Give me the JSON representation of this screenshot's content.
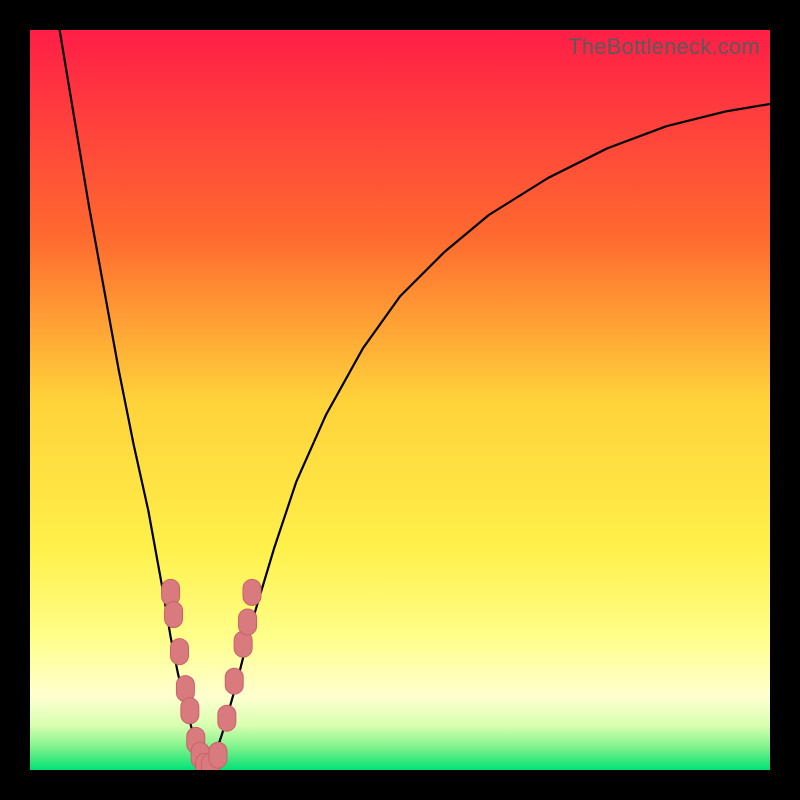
{
  "watermark": "TheBottleneck.com",
  "colors": {
    "frame_bg": "#000000",
    "gradient_stops": [
      {
        "offset": 0.0,
        "color": "#ff1e47"
      },
      {
        "offset": 0.28,
        "color": "#ff6a2f"
      },
      {
        "offset": 0.5,
        "color": "#ffd23a"
      },
      {
        "offset": 0.7,
        "color": "#fff04a"
      },
      {
        "offset": 0.82,
        "color": "#ffff8a"
      },
      {
        "offset": 0.9,
        "color": "#ffffd0"
      },
      {
        "offset": 0.94,
        "color": "#d8ffb0"
      },
      {
        "offset": 0.97,
        "color": "#7df28a"
      },
      {
        "offset": 1.0,
        "color": "#00e277"
      }
    ],
    "curve_stroke": "#000000",
    "marker_fill": "#d97a7e",
    "marker_stroke": "#c96168"
  },
  "chart_data": {
    "type": "line",
    "title": "",
    "xlabel": "",
    "ylabel": "",
    "xlim": [
      0,
      100
    ],
    "ylim": [
      0,
      100
    ],
    "series": [
      {
        "name": "left-branch",
        "x": [
          4,
          6,
          8,
          10,
          12,
          14,
          16,
          18,
          19,
          20,
          21,
          22,
          23,
          24
        ],
        "y": [
          100,
          88,
          76,
          65,
          54,
          44,
          35,
          24,
          18,
          13,
          9,
          5,
          2,
          0
        ]
      },
      {
        "name": "right-branch",
        "x": [
          24,
          25,
          26,
          28,
          30,
          33,
          36,
          40,
          45,
          50,
          56,
          62,
          70,
          78,
          86,
          94,
          100
        ],
        "y": [
          0,
          2,
          5,
          12,
          20,
          30,
          39,
          48,
          57,
          64,
          70,
          75,
          80,
          84,
          87,
          89,
          90
        ]
      }
    ],
    "markers": [
      {
        "branch": "left",
        "x": 19.0,
        "y": 24
      },
      {
        "branch": "left",
        "x": 19.4,
        "y": 21
      },
      {
        "branch": "left",
        "x": 20.2,
        "y": 16
      },
      {
        "branch": "left",
        "x": 21.0,
        "y": 11
      },
      {
        "branch": "left",
        "x": 21.6,
        "y": 8
      },
      {
        "branch": "left",
        "x": 22.4,
        "y": 4
      },
      {
        "branch": "left",
        "x": 23.0,
        "y": 2
      },
      {
        "branch": "valley",
        "x": 23.6,
        "y": 0.5
      },
      {
        "branch": "valley",
        "x": 24.4,
        "y": 0.5
      },
      {
        "branch": "right",
        "x": 25.4,
        "y": 2
      },
      {
        "branch": "right",
        "x": 26.6,
        "y": 7
      },
      {
        "branch": "right",
        "x": 27.6,
        "y": 12
      },
      {
        "branch": "right",
        "x": 28.8,
        "y": 17
      },
      {
        "branch": "right",
        "x": 29.4,
        "y": 20
      },
      {
        "branch": "right",
        "x": 30.0,
        "y": 24
      }
    ]
  }
}
